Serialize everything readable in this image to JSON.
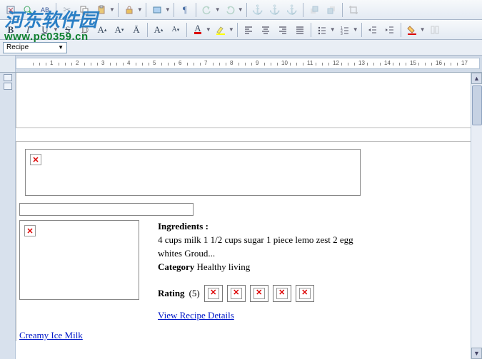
{
  "watermark": {
    "line1": "河东软件园",
    "line2": "www.pc0359.cn"
  },
  "toolbar1": {
    "items": [
      "edit",
      "find",
      "replace",
      "sep",
      "copy",
      "paste",
      "paste-special",
      "sep",
      "permissions",
      "sep",
      "object",
      "sep",
      "para-mark",
      "sep",
      "undo",
      "redo",
      "sep",
      "anchor",
      "anchor2",
      "anchor3",
      "sep",
      "group",
      "ungroup",
      "sep",
      "crop"
    ]
  },
  "toolbar2": {
    "bold": "B",
    "italic": "I",
    "underline": "U",
    "strike": "S",
    "outline": "D",
    "superscript": "A",
    "subscript": "A",
    "case": "A"
  },
  "styleBar": {
    "label": "Recipe"
  },
  "ruler": {
    "max": 17
  },
  "document": {
    "ingredients_label": "Ingredients :",
    "ingredients_text": "4 cups milk 1 1/2 cups sugar 1 piece lemo zest 2 egg whites Groud...",
    "category_label": "Category",
    "category_value": "Healthy living",
    "rating_label": "Rating",
    "rating_count": "(5)",
    "recipe_link": "Creamy Ice Milk",
    "details_link": "View Recipe Details"
  }
}
